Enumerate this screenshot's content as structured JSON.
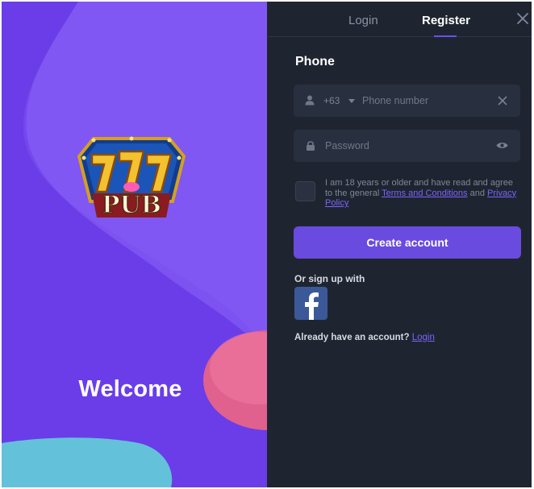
{
  "left": {
    "welcome": "Welcome",
    "logo": {
      "top_text": "777",
      "bottom_text": "PUB"
    }
  },
  "tabs": {
    "login": "Login",
    "register": "Register"
  },
  "form": {
    "title": "Phone",
    "phone": {
      "country_code": "+63",
      "placeholder": "Phone number"
    },
    "password": {
      "placeholder": "Password"
    },
    "terms": {
      "prefix": "I am 18 years or older and have read and agree to the general",
      "terms_link": "Terms and Conditions",
      "and": "and",
      "privacy_link": "Privacy Policy"
    },
    "create_button": "Create account",
    "or_signup": "Or sign up with",
    "already_text": "Already have an account?",
    "login_link": "Login"
  },
  "colors": {
    "left_bg": "#6a3de8",
    "right_bg": "#1f2530",
    "accent": "#6a4bdf",
    "facebook": "#3b5998"
  },
  "icons": [
    "close-icon",
    "user-icon",
    "chevron-down-icon",
    "clear-icon",
    "lock-icon",
    "eye-icon",
    "facebook-icon"
  ]
}
